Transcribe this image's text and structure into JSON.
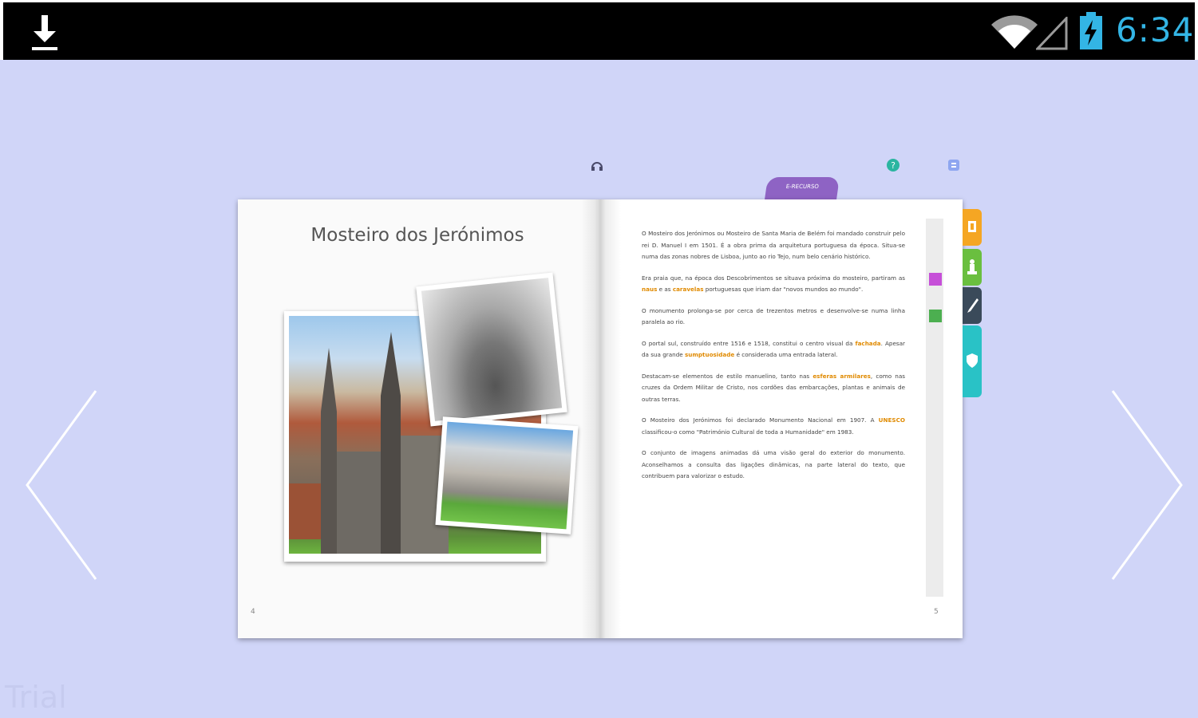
{
  "status_bar": {
    "time": "6:34",
    "icons": [
      "download-icon",
      "wifi-icon",
      "signal-icon",
      "battery-charging-icon"
    ],
    "time_color": "#33b5e5"
  },
  "book": {
    "left_page": {
      "title": "Mosteiro dos Jerónimos",
      "page_number": "4"
    },
    "right_page": {
      "page_number": "5",
      "paragraphs": [
        "O Mosteiro dos Jerónimos ou Mosteiro de Santa Maria de Belém foi mandado construir pelo rei D. Manuel I em 1501. É a obra prima da arquitetura portuguesa da época. Situa-se numa das zonas nobres de Lisboa, junto ao rio Tejo, num belo cenário histórico.",
        "Era praia que, na época dos Descobrimentos se situava próxima do mosteiro, partiram as naus e as caravelas portuguesas que iriam dar \"novos mundos ao mundo\".",
        "O monumento prolonga-se por cerca de trezentos metros e desenvolve-se numa linha paralela ao rio.",
        "O portal sul, construído entre 1516 e 1518, constitui o centro visual da fachada. Apesar da sua grande sumptuosidade é considerada uma entrada lateral.",
        "Destacam-se elementos de estilo manuelino, tanto nas esferas armilares, como nas cruzes da Ordem Militar de Cristo, nos cordões das embarcações, plantas e animais de outras terras.",
        "O Mosteiro dos Jerónimos foi declarado Monumento Nacional em 1907. A UNESCO classificou-o como \"Património Cultural de toda a Humanidade\" em 1983.",
        "O conjunto de imagens animadas dá uma visão geral do exterior do monumento. Aconselhamos a consulta das ligações dinâmicas, na parte lateral do texto, que contribuem para valorizar o estudo."
      ]
    },
    "ribbon_label": "E-RECURSO"
  },
  "nav": {
    "prev": "chevron-left-icon",
    "next": "chevron-right-icon"
  },
  "watermark": "Trial",
  "colors": {
    "background": "#d0d5f8",
    "highlight": "#e08a00",
    "tab_orange": "#f5a623",
    "tab_green": "#6abf3f",
    "tab_dark": "#3a4a5a",
    "tab_cyan": "#29c2c6",
    "ribbon": "#8e63c4"
  }
}
